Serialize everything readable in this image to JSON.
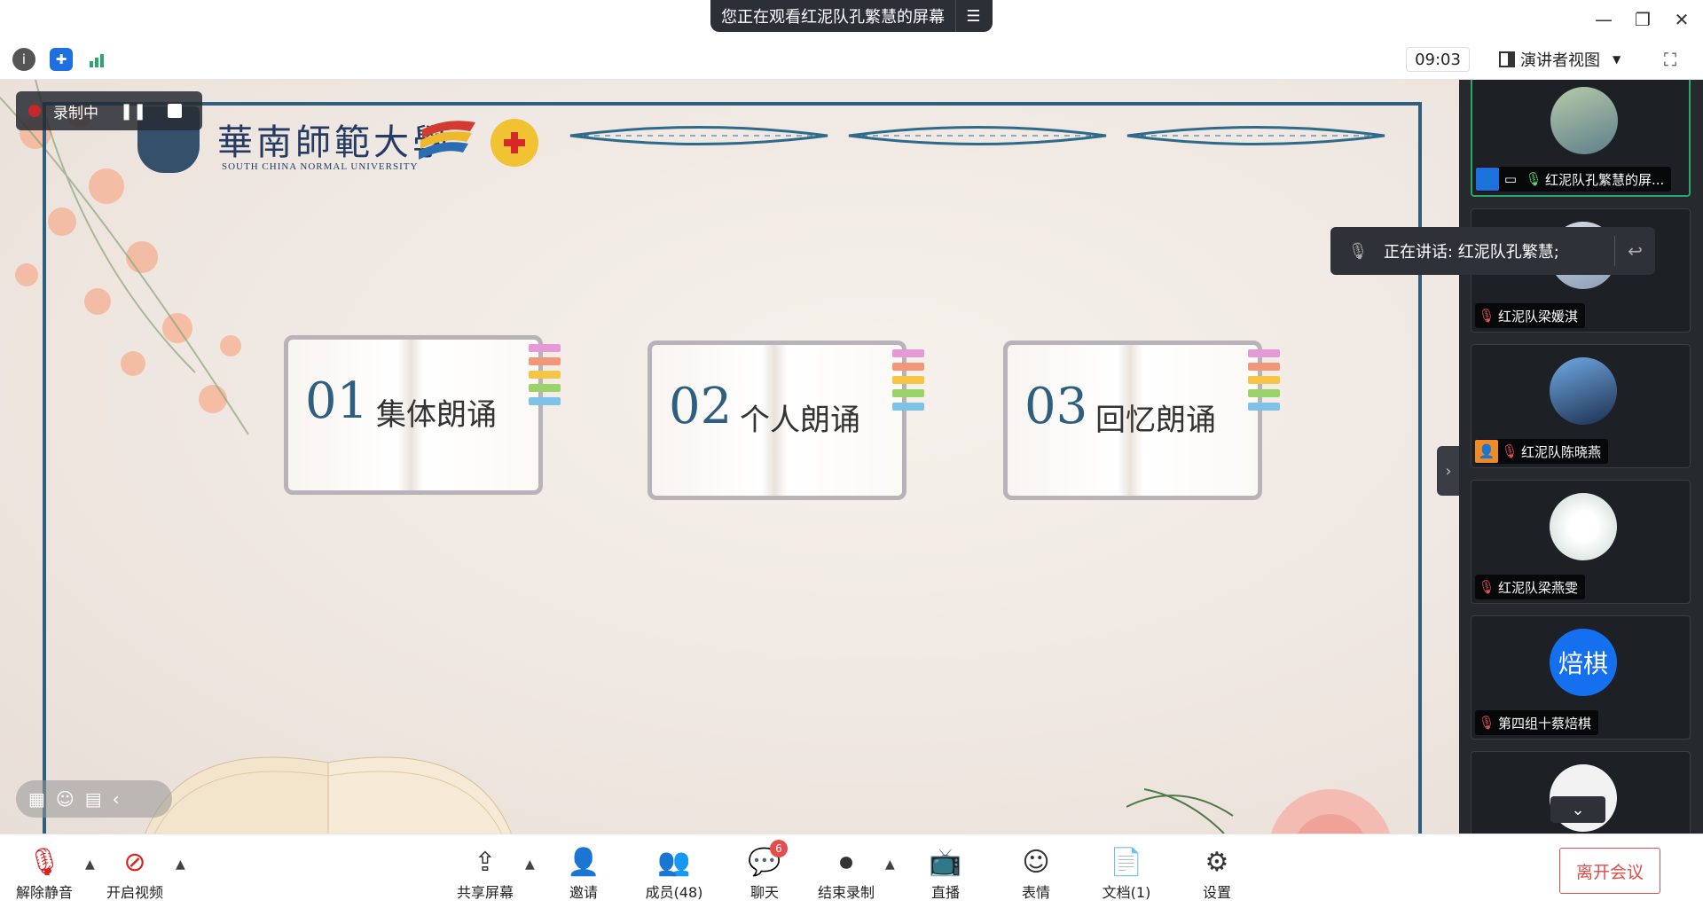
{
  "titlebar": {
    "share_banner": "您正在观看红泥队孔繁慧的屏幕",
    "window_controls": [
      "minimize-icon",
      "restore-icon",
      "close-icon"
    ]
  },
  "toolbar": {
    "info_icon": "info-icon",
    "security_icon": "shield-icon",
    "signal_icon": "signal-icon",
    "timer": "09:03",
    "view_mode": "演讲者视图"
  },
  "recording": {
    "label": "录制中"
  },
  "slide": {
    "university_name": "華南師範大學",
    "university_sub": "SOUTH CHINA NORMAL UNIVERSITY",
    "cards": [
      {
        "num": "01",
        "label": "集体朗诵"
      },
      {
        "num": "02",
        "label": "个人朗诵"
      },
      {
        "num": "03",
        "label": "回忆朗诵"
      }
    ]
  },
  "speaking_toast": {
    "text": "正在讲话: 红泥队孔繁慧;"
  },
  "participants": [
    {
      "name": "红泥队孔繁慧的屏...",
      "avatar": "photo",
      "active": true
    },
    {
      "name": "红泥队梁媛淇",
      "avatar": "photo"
    },
    {
      "name": "红泥队陈晓燕",
      "avatar": "photo"
    },
    {
      "name": "红泥队梁燕雯",
      "avatar": "cartoon"
    },
    {
      "name": "第四组十蔡焙棋",
      "avatar_text": "焙棋"
    },
    {
      "name": "",
      "avatar": "default"
    }
  ],
  "controls": {
    "unmute": "解除静音",
    "start_video": "开启视频",
    "share_screen": "共享屏幕",
    "invite": "邀请",
    "members": "成员(48)",
    "chat": "聊天",
    "chat_badge": "6",
    "end_record": "结束录制",
    "live": "直播",
    "reactions": "表情",
    "docs": "文档(1)",
    "settings": "设置",
    "leave": "离开会议"
  },
  "colors": {
    "accent_blue": "#2e5f7f",
    "leave_red": "#e04b4b",
    "panel_bg": "#26292e",
    "active_green": "#2aa76a"
  }
}
